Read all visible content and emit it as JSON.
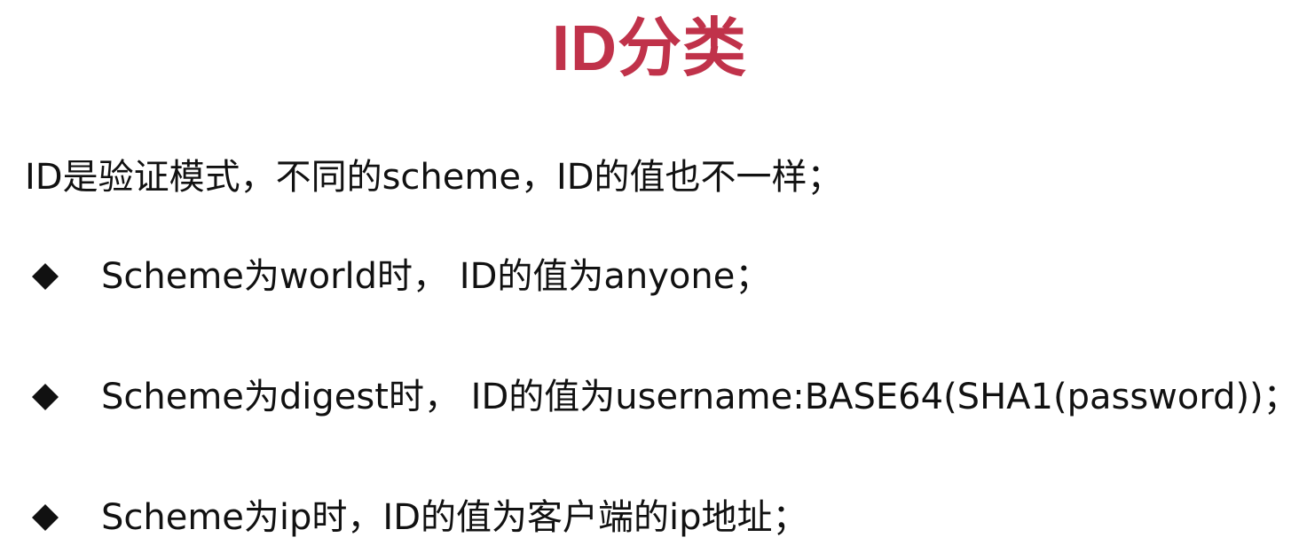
{
  "slide": {
    "title": "ID分类",
    "intro": "ID是验证模式，不同的scheme，ID的值也不一样；",
    "bullets": [
      {
        "icon": "diamond-bullet-icon",
        "text": "Scheme为world时，  ID的值为anyone；"
      },
      {
        "icon": "diamond-bullet-icon",
        "text": "Scheme为digest时，  ID的值为username:BASE64(SHA1(password))；"
      },
      {
        "icon": "diamond-bullet-icon",
        "text": "Scheme为ip时，ID的值为客户端的ip地址；"
      }
    ]
  },
  "colors": {
    "title": "#c0324a",
    "text": "#111111",
    "background": "#ffffff"
  }
}
